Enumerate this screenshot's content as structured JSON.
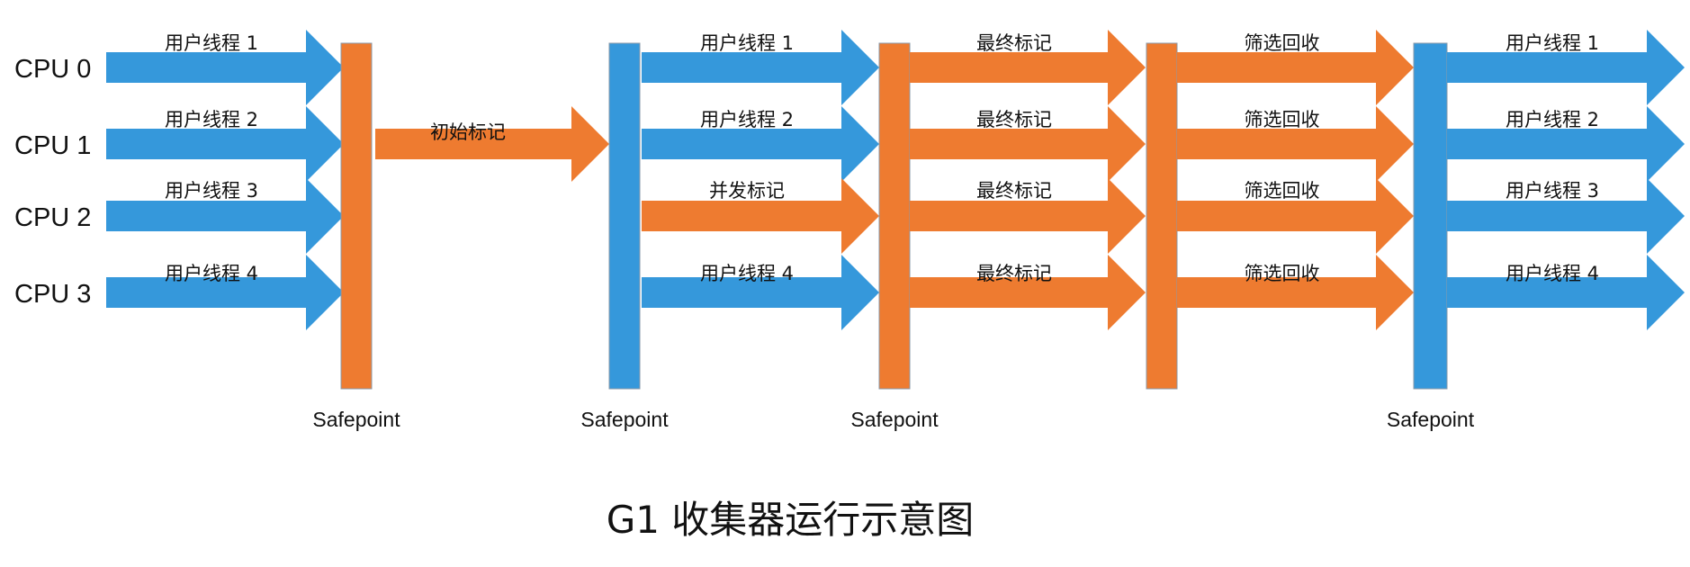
{
  "colors": {
    "blue": "#3598db",
    "orange": "#ee7b30",
    "bar_stroke": "#8a9aa8"
  },
  "title": "G1 收集器运行示意图",
  "cpus": [
    "CPU 0",
    "CPU 1",
    "CPU 2",
    "CPU 3"
  ],
  "safepoint_label": "Safepoint",
  "phases": [
    {
      "kind": "lanes",
      "labels": [
        "用户线程 1",
        "用户线程 2",
        "用户线程 3",
        "用户线程 4"
      ],
      "colors": [
        "blue",
        "blue",
        "blue",
        "blue"
      ]
    },
    {
      "kind": "safepoint",
      "color": "orange",
      "label": "Safepoint"
    },
    {
      "kind": "single",
      "label": "初始标记",
      "color": "orange",
      "lane": 1
    },
    {
      "kind": "safepoint",
      "color": "blue",
      "label": "Safepoint"
    },
    {
      "kind": "lanes",
      "labels": [
        "用户线程 1",
        "用户线程 2",
        "并发标记",
        "用户线程 4"
      ],
      "colors": [
        "blue",
        "blue",
        "orange",
        "blue"
      ]
    },
    {
      "kind": "safepoint",
      "color": "orange",
      "label": "Safepoint"
    },
    {
      "kind": "lanes",
      "labels": [
        "最终标记",
        "最终标记",
        "最终标记",
        "最终标记"
      ],
      "colors": [
        "orange",
        "orange",
        "orange",
        "orange"
      ]
    },
    {
      "kind": "safepoint",
      "color": "orange",
      "label": ""
    },
    {
      "kind": "lanes",
      "labels": [
        "筛选回收",
        "筛选回收",
        "筛选回收",
        "筛选回收"
      ],
      "colors": [
        "orange",
        "orange",
        "orange",
        "orange"
      ]
    },
    {
      "kind": "safepoint",
      "color": "blue",
      "label": "Safepoint"
    },
    {
      "kind": "lanes",
      "labels": [
        "用户线程 1",
        "用户线程 2",
        "用户线程 3",
        "用户线程 4"
      ],
      "colors": [
        "blue",
        "blue",
        "blue",
        "blue"
      ]
    }
  ]
}
